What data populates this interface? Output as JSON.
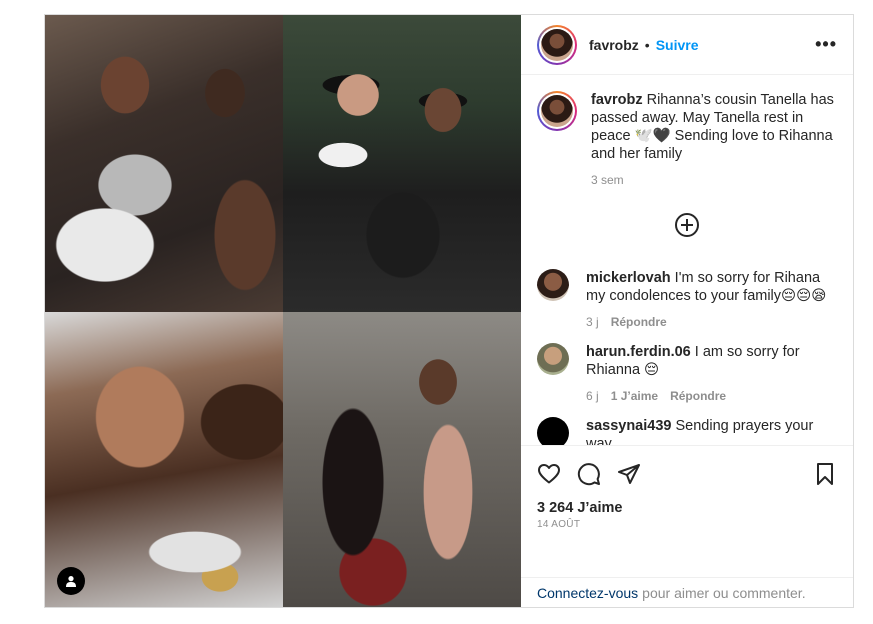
{
  "header": {
    "username": "favrobz",
    "separator": "•",
    "follow_label": "Suivre",
    "more_label": "•••"
  },
  "caption": {
    "username": "favrobz",
    "text": "Rihanna’s cousin Tanella has passed away. May Tanella rest in peace 🕊️🖤 Sending love to Rihanna and her family",
    "time": "3 sem"
  },
  "load_more_icon": "plus-circle-icon",
  "comments": [
    {
      "username": "mickerlovah",
      "text": "I'm so sorry for Rihana my condolences to your family😔😔😪",
      "time": "3 j",
      "likes": "",
      "reply_label": "Répondre"
    },
    {
      "username": "harun.ferdin.06",
      "text": "I am so sorry for Rhianna 😔",
      "time": "6 j",
      "likes": "1 J’aime",
      "reply_label": "Répondre"
    },
    {
      "username": "sassynai439",
      "text": "Sending prayers your way",
      "time": "",
      "likes": "",
      "reply_label": ""
    }
  ],
  "actions": {
    "like_icon": "heart-icon",
    "comment_icon": "comment-icon",
    "share_icon": "paper-plane-icon",
    "save_icon": "bookmark-icon"
  },
  "likes_count": "3 264 J’aime",
  "post_date": "14 AOÛT",
  "login_bar": {
    "link": "Connectez-vous",
    "text": "pour aimer ou commenter."
  },
  "colors": {
    "accent": "#0095f6",
    "link_dark": "#00376b",
    "muted": "#8e8e8e",
    "text": "#262626",
    "border": "#dbdbdb"
  }
}
